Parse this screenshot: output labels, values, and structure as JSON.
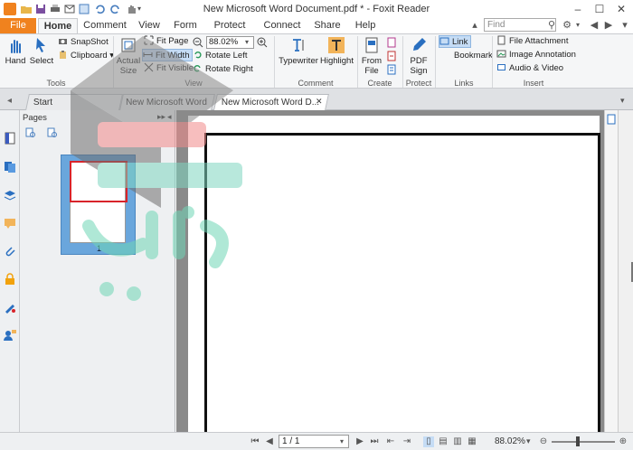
{
  "window": {
    "title": "New Microsoft Word Document.pdf * - Foxit Reader"
  },
  "ribbon_tabs": {
    "file": "File",
    "home": "Home",
    "comment": "Comment",
    "view": "View",
    "form": "Form",
    "protect": "Protect",
    "connect": "Connect",
    "share": "Share",
    "help": "Help"
  },
  "search": {
    "placeholder": "Find"
  },
  "tools": {
    "hand": "Hand",
    "select": "Select",
    "snapshot": "SnapShot",
    "clipboard": "Clipboard",
    "group": "Tools"
  },
  "view_group": {
    "actual_size_1": "Actual",
    "actual_size_2": "Size",
    "fit_page": "Fit Page",
    "fit_width": "Fit Width",
    "fit_visible": "Fit Visible",
    "zoom": "88.02%",
    "rotate_left": "Rotate Left",
    "rotate_right": "Rotate Right",
    "group": "View"
  },
  "comment_group": {
    "typewriter": "Typewriter",
    "highlight": "Highlight",
    "group": "Comment"
  },
  "create_group": {
    "from_file_1": "From",
    "from_file_2": "File",
    "group": "Create"
  },
  "protect_group": {
    "pdf_sign_1": "PDF",
    "pdf_sign_2": "Sign",
    "group": "Protect"
  },
  "links_group": {
    "link": "Link",
    "bookmark": "Bookmark",
    "group": "Links"
  },
  "insert_group": {
    "file_attachment": "File Attachment",
    "image_annotation": "Image Annotation",
    "audio_video": "Audio & Video",
    "group": "Insert"
  },
  "doc_tabs": [
    {
      "label": "Start"
    },
    {
      "label": "New Microsoft Word ..."
    },
    {
      "label": "New Microsoft Word D..."
    }
  ],
  "pages_panel": {
    "title": "Pages",
    "thumb_number": "1"
  },
  "status": {
    "page": "1 / 1",
    "zoom": "88.02%"
  },
  "colors": {
    "file_tab": "#f0821e",
    "selection": "#6aa6dc",
    "viewport": "#d8232a",
    "accent_blue": "#2a6fc0"
  }
}
